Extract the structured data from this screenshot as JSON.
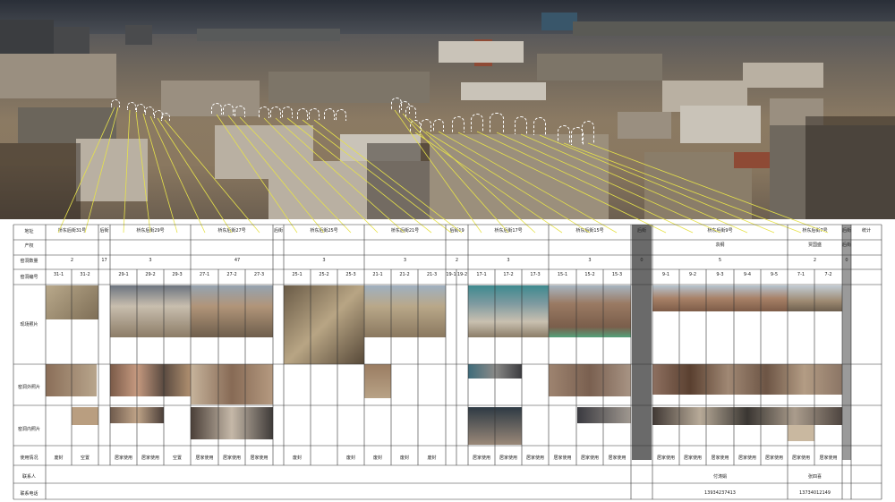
{
  "row_labels": [
    "地址",
    "产权",
    "窑洞数量",
    "窑洞编号",
    "现场照片",
    "窑洞外照片",
    "窑洞内照片",
    "使用情况",
    "联系人",
    "联系电话"
  ],
  "addresses": [
    "桥东后街31号",
    "后街",
    "桥东后街29号",
    "桥东后街27号",
    "后街",
    "桥东后街25号",
    "桥东后街21号",
    "后街19",
    "桥东后街17号",
    "桥东后街15号",
    "后街",
    "桥东后街9号",
    "桥东后街7号",
    "后街",
    "统计"
  ],
  "ownership": [
    "袁纲",
    "贾国盛",
    "后街"
  ],
  "counts": [
    "2",
    "17",
    "3",
    "47",
    "3",
    "3",
    "2",
    "3",
    "3",
    "0",
    "5",
    "2",
    "0"
  ],
  "codes": [
    "31-1",
    "31-2",
    "29-1",
    "29-2",
    "29-3",
    "27-1",
    "27-2",
    "27-3",
    "25-1",
    "25-2",
    "25-3",
    "21-1",
    "21-2",
    "21-3",
    "19-1",
    "19-2",
    "17-1",
    "17-2",
    "17-3",
    "15-1",
    "15-2",
    "15-3",
    "9-1",
    "9-2",
    "9-3",
    "9-4",
    "9-5",
    "7-1",
    "7-2"
  ],
  "usage": [
    "废封",
    "空置",
    "居家使用",
    "居家使用",
    "空置",
    "居家使用",
    "居家使用",
    "居家使用",
    "废封",
    "废封",
    "废封",
    "废封",
    "废封",
    "居家使用",
    "居家使用",
    "居家使用",
    "居家使用",
    "居家使用",
    "居家使用",
    "居家使用",
    "居家使用",
    "居家使用",
    "居家使用",
    "居家使用",
    "居家使用",
    "居家使用"
  ],
  "contacts": [
    "付涛娟",
    "张四喜"
  ],
  "phones": [
    "13934237413",
    "13734012149"
  ],
  "colors": {
    "callout_line": "#e6e24a",
    "arch_marker": "#ffffff",
    "grid": "#333333",
    "dark_column": "#6a6a6a"
  }
}
